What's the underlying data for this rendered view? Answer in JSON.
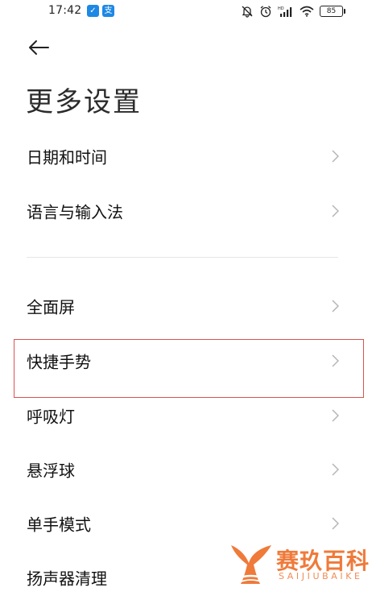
{
  "status_bar": {
    "time": "17:42",
    "battery": "85",
    "app_badges": [
      "✓",
      "支"
    ],
    "icons": [
      "mute-icon",
      "alarm-icon",
      "hd-signal-icon",
      "wifi-icon",
      "battery-icon"
    ]
  },
  "header": {
    "back_icon": "arrow-left-icon",
    "title": "更多设置"
  },
  "settings": {
    "group1": [
      {
        "label": "日期和时间"
      },
      {
        "label": "语言与输入法"
      }
    ],
    "group2": [
      {
        "label": "全面屏"
      },
      {
        "label": "快捷手势"
      },
      {
        "label": "呼吸灯"
      },
      {
        "label": "悬浮球"
      },
      {
        "label": "单手模式"
      },
      {
        "label": "扬声器清理"
      }
    ]
  },
  "highlight": {
    "target": "快捷手势",
    "color": "#d9534f"
  },
  "watermark": {
    "text": "赛玖百科",
    "subtext": "SAIJIUBAIKE",
    "color": "#ef7a3a"
  }
}
